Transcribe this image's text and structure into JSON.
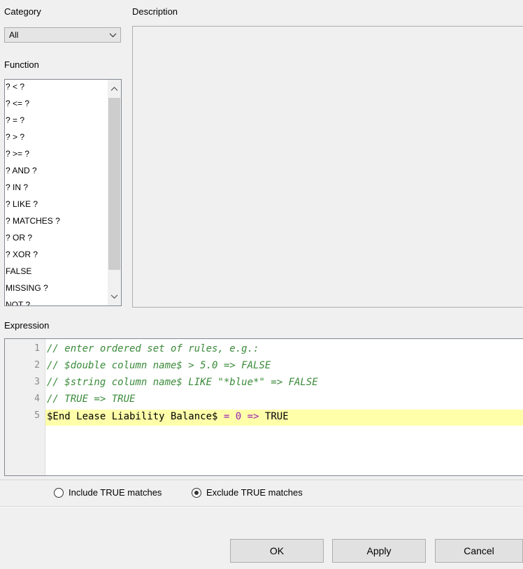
{
  "category": {
    "label": "Category",
    "selected": "All"
  },
  "description": {
    "label": "Description"
  },
  "function": {
    "label": "Function",
    "items": [
      "? < ?",
      "? <= ?",
      "? = ?",
      "? > ?",
      "? >= ?",
      "? AND ?",
      "? IN ?",
      "? LIKE ?",
      "? MATCHES ?",
      "? OR ?",
      "? XOR ?",
      "FALSE",
      "MISSING ?",
      "NOT ?"
    ]
  },
  "expression": {
    "label": "Expression",
    "line_numbers": [
      "1",
      "2",
      "3",
      "4",
      "5"
    ],
    "lines": [
      "// enter ordered set of rules, e.g.:",
      "// $double column name$ > 5.0 => FALSE",
      "// $string column name$ LIKE \"*blue*\" => FALSE",
      "// TRUE => TRUE"
    ],
    "rule": {
      "column": "$End Lease Liability Balance$",
      "eq": "=",
      "value": "0",
      "arrow": "=>",
      "result": "TRUE"
    }
  },
  "matches": {
    "include_label": "Include TRUE matches",
    "exclude_label": "Exclude TRUE matches",
    "selected": "exclude"
  },
  "buttons": {
    "ok": "OK",
    "apply": "Apply",
    "cancel": "Cancel"
  },
  "colors": {
    "highlight": "#ffffaa",
    "comment": "#3a8a3a",
    "operator": "#9b1fb0"
  }
}
